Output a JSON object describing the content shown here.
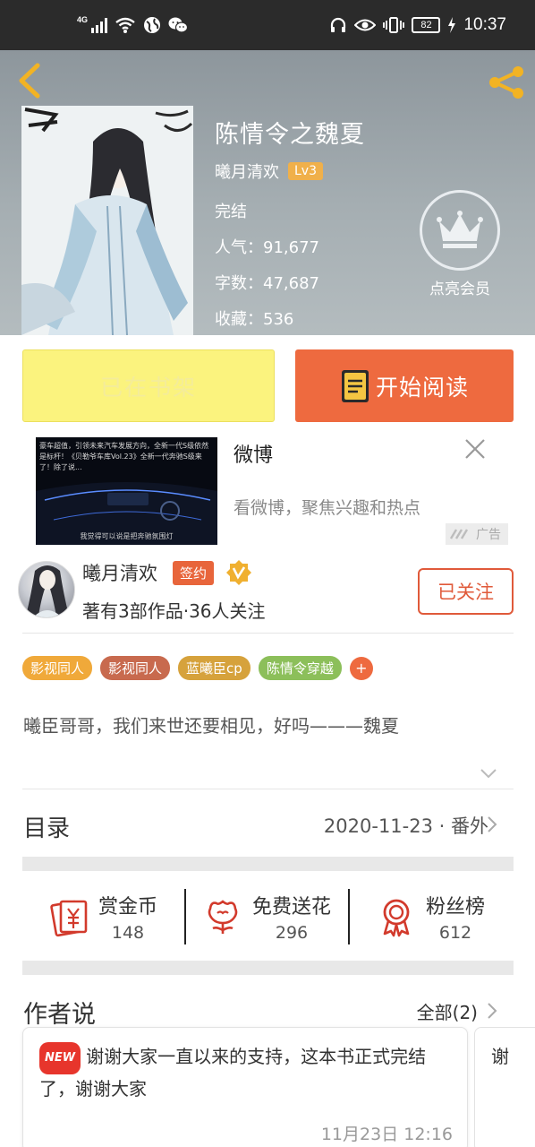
{
  "status_bar": {
    "network": "4G",
    "battery": "82",
    "time": "10:37"
  },
  "book": {
    "title": "陈情令之魏夏",
    "author": "曦月清欢",
    "level": "Lv3",
    "status": "完结",
    "popularity": "人气：91,677",
    "word_count": "字数：47,687",
    "favorites": "收藏：536",
    "vip_label": "点亮会员"
  },
  "actions": {
    "shelf_label": "已在书架",
    "read_label": "开始阅读"
  },
  "ad": {
    "image_text": "豪车超值，引领未来汽车发展方向，全新一代S级依然是标杆！《贝勒爷车库Vol.23》全新一代奔驰S级来了！除了说...",
    "image_caption": "我觉得可以说是把奔驰氛围灯",
    "title": "微博",
    "description": "看微博，聚焦兴趣和热点",
    "tag": "广告"
  },
  "author": {
    "name": "曦月清欢",
    "sign_badge": "签约",
    "stats": "著有3部作品·36人关注",
    "follow_label": "已关注"
  },
  "tags": [
    {
      "label": "影视同人",
      "color": "#f0a93a"
    },
    {
      "label": "影视同人",
      "color": "#c86a4e"
    },
    {
      "label": "蓝曦臣cp",
      "color": "#d6a23c"
    },
    {
      "label": "陈情令穿越",
      "color": "#8cbf5a"
    }
  ],
  "tag_more": "+",
  "intro": "曦臣哥哥，我们来世还要相见，好吗———魏夏",
  "catalog": {
    "title": "目录",
    "latest": "2020-11-23 · 番外"
  },
  "stats": [
    {
      "label": "赏金币",
      "value": "148"
    },
    {
      "label": "免费送花",
      "value": "296"
    },
    {
      "label": "粉丝榜",
      "value": "612"
    }
  ],
  "author_says": {
    "title": "作者说",
    "all_label": "全部(2)",
    "new_badge": "NEW",
    "message": "谢谢大家一直以来的支持，这本书正式完结了，谢谢大家",
    "time": "11月23日  12:16",
    "next_preview": "谢"
  },
  "colors": {
    "accent": "#ee6a3f",
    "shelf": "#fbf37e",
    "level_badge": "#f0b04a",
    "stat_icon": "#d23a2c"
  }
}
